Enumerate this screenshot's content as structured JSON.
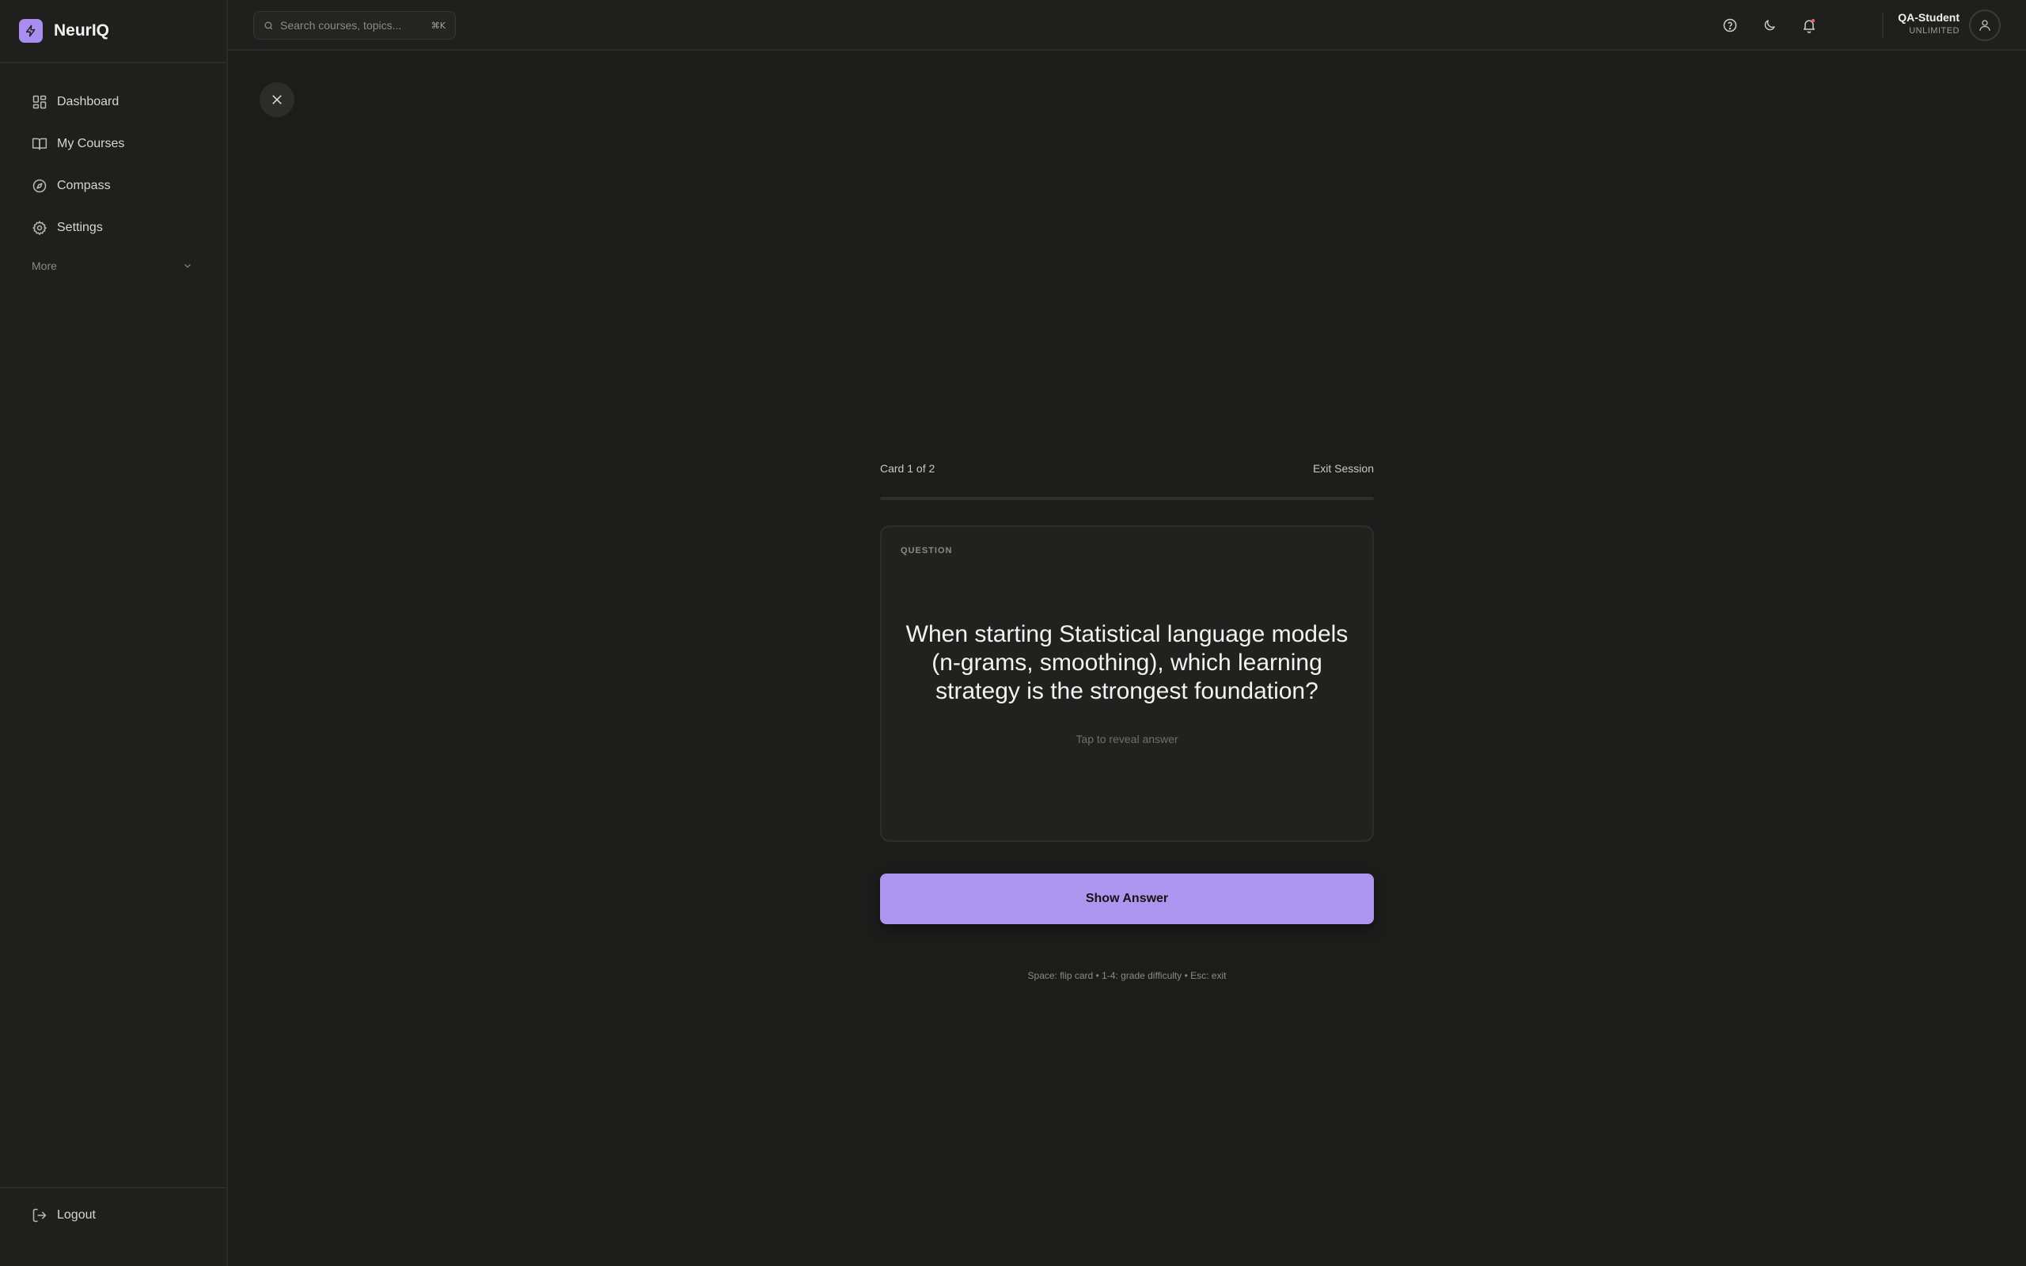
{
  "brand": {
    "name": "NeurIQ"
  },
  "nav": {
    "items": [
      {
        "label": "Dashboard",
        "icon": "dashboard-grid-icon"
      },
      {
        "label": "My Courses",
        "icon": "book-icon"
      },
      {
        "label": "Compass",
        "icon": "compass-icon"
      },
      {
        "label": "Settings",
        "icon": "gear-icon"
      }
    ],
    "more_label": "More",
    "logout_label": "Logout"
  },
  "topbar": {
    "search_placeholder": "Search courses, topics...",
    "search_shortcut": "⌘K",
    "user_name": "QA-Student",
    "user_plan": "UNLIMITED"
  },
  "session": {
    "counter": "Card 1 of 2",
    "exit_label": "Exit Session",
    "progress": 0
  },
  "card": {
    "label": "QUESTION",
    "question": "When starting Statistical language models (n-grams, smoothing), which learning strategy is the strongest foundation?",
    "reveal_hint": "Tap to reveal answer"
  },
  "actions": {
    "show_answer": "Show Answer"
  },
  "shortcuts": "Space: flip card • 1-4: grade difficulty • Esc: exit",
  "colors": {
    "accent": "#ad96f0",
    "background": "#1c1c1b",
    "sidebar": "#1f1f1e"
  }
}
